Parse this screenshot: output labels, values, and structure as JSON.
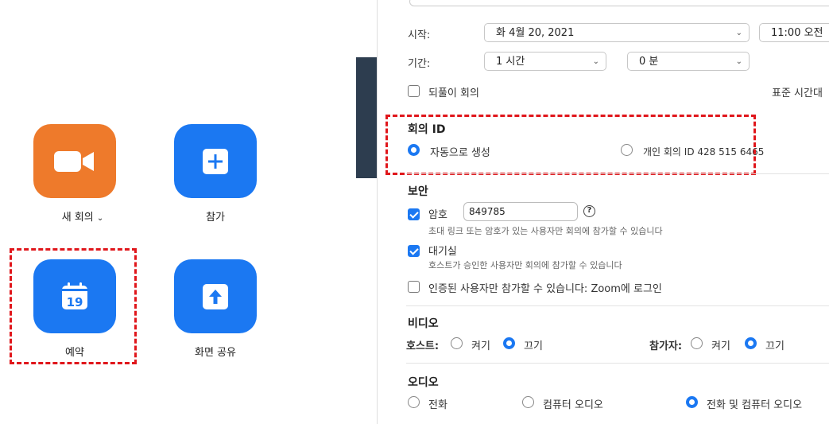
{
  "home": {
    "new_meeting": "새 회의",
    "join": "참가",
    "schedule": "예약",
    "share_screen": "화면 공유",
    "calendar_day": "19"
  },
  "schedule_form": {
    "start_label": "시작:",
    "start_date": "화 4월 20, 2021",
    "start_time": "11:00 오전",
    "duration_label": "기간:",
    "duration_hours": "1 시간",
    "duration_minutes": "0 분",
    "recurring_label": "되풀이 회의",
    "timezone_label": "표준 시간대",
    "meeting_id": {
      "title": "회의 ID",
      "auto_label": "자동으로 생성",
      "personal_label": "개인 회의 ID 428 515 6465"
    },
    "security": {
      "title": "보안",
      "password_label": "암호",
      "password_value": "849785",
      "password_help": "?",
      "password_desc": "초대 링크 또는 암호가 있는 사용자만 회의에 참가할 수 있습니다",
      "waiting_label": "대기실",
      "waiting_desc": "호스트가 승인한 사용자만 회의에 참가할 수 있습니다",
      "auth_label": "인증된 사용자만 참가할 수 있습니다: Zoom에 로그인"
    },
    "video": {
      "title": "비디오",
      "host_label": "호스트:",
      "participant_label": "참가자:",
      "on": "켜기",
      "off": "끄기"
    },
    "audio": {
      "title": "오디오",
      "phone": "전화",
      "computer": "컴퓨터 오디오",
      "both": "전화 및 컴퓨터 오디오"
    }
  },
  "colors": {
    "accent_blue": "#1b78f2",
    "accent_orange": "#ee7a2b",
    "highlight_red": "#e0161b"
  }
}
